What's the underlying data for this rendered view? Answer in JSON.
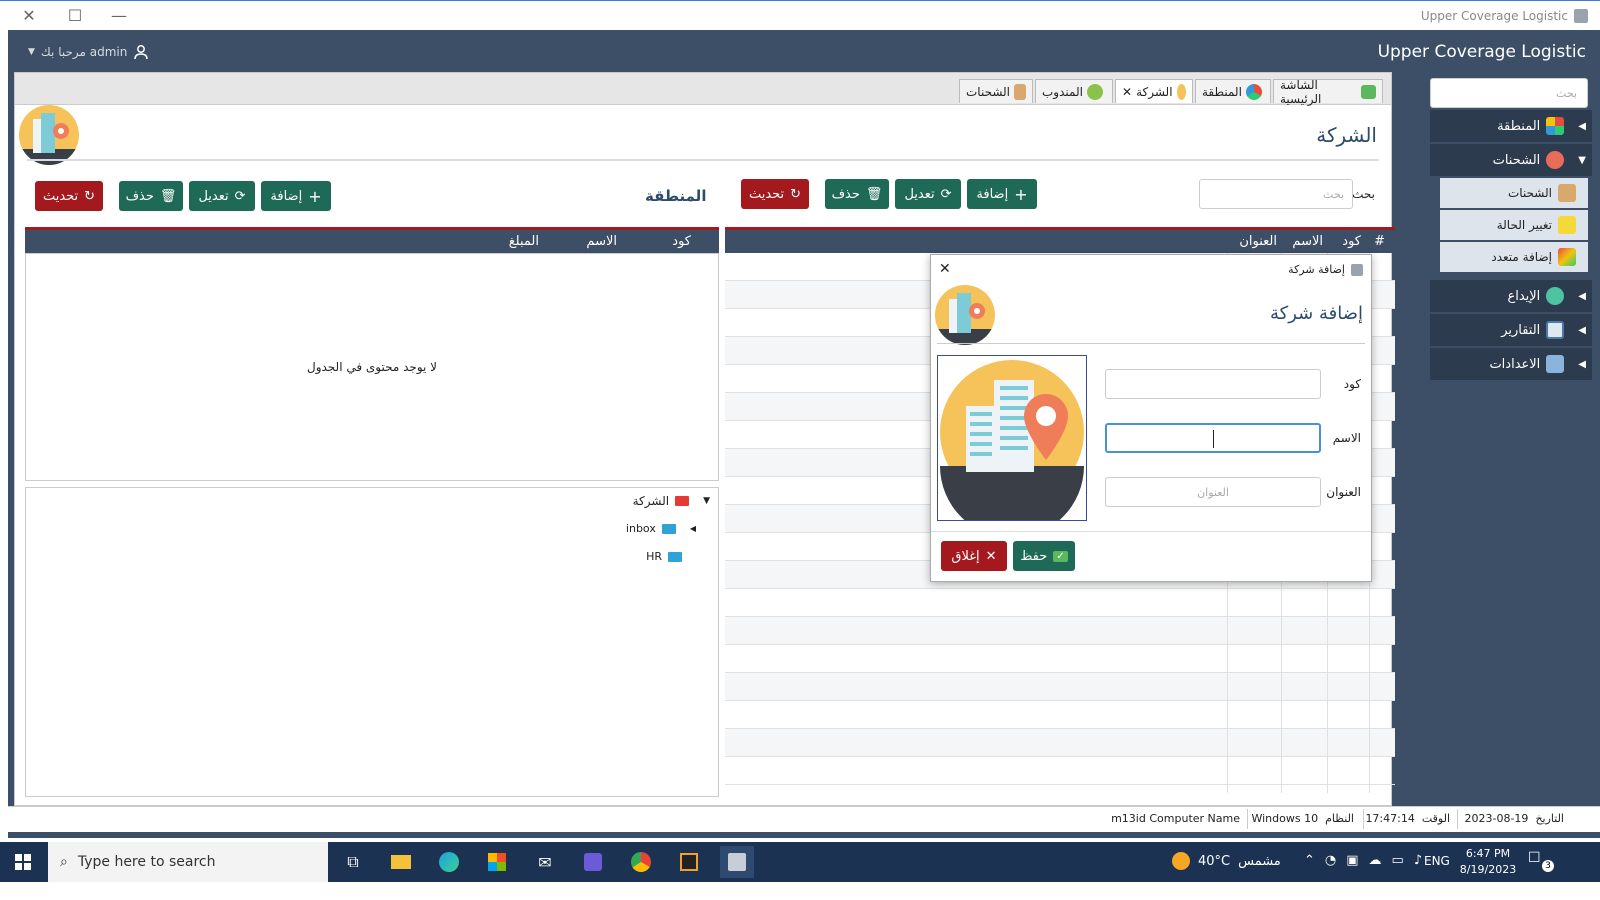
{
  "window": {
    "title": "Upper Coverage Logistic"
  },
  "header": {
    "brand": "Upper Coverage Logistic",
    "user": "مرحبا بك admin"
  },
  "sidebar": {
    "search_placeholder": "بحث",
    "items": [
      {
        "label": "المنطقة"
      },
      {
        "label": "الشحنات"
      },
      {
        "label": "الإيداع"
      },
      {
        "label": "التقارير"
      },
      {
        "label": "الاعدادات"
      }
    ],
    "sub_items": [
      {
        "label": "الشحنات"
      },
      {
        "label": "تغيير الحالة"
      },
      {
        "label": "إضافة متعدد"
      }
    ]
  },
  "tabs": [
    {
      "label": "الشاشة الرئيسية"
    },
    {
      "label": "المنطقة"
    },
    {
      "label": "الشركة"
    },
    {
      "label": "المندوب"
    },
    {
      "label": "الشحنات"
    }
  ],
  "page": {
    "title": "الشركة"
  },
  "company": {
    "search_label": "بحث",
    "search_placeholder": "بحث",
    "buttons": {
      "add": "إضافة",
      "edit": "تعديل",
      "delete": "حذف",
      "refresh": "تحديث"
    },
    "columns": [
      "#",
      "كود",
      "الاسم",
      "العنوان"
    ]
  },
  "region": {
    "title": "المنطقة",
    "buttons": {
      "add": "إضافة",
      "edit": "تعديل",
      "delete": "حذف",
      "refresh": "تحديث"
    },
    "columns": [
      "كود",
      "الاسم",
      "المبلغ"
    ],
    "empty": "لا يوجد محتوى في الجدول"
  },
  "tree": {
    "root": "الشركة",
    "children": [
      "inbox",
      "HR"
    ]
  },
  "modal": {
    "window_title": "إضافة شركة",
    "heading": "إضافة شركة",
    "fields": {
      "code_label": "كود",
      "name_label": "الاسم",
      "address_label": "العنوان",
      "address_placeholder": "العنوان"
    },
    "save": "حفظ",
    "close": "إغلاق"
  },
  "status": {
    "date_label": "التاريخ",
    "date": "2023-08-19",
    "time_label": "الوقت",
    "time": "17:47:14",
    "os_label": "النظام",
    "os": "Windows 10",
    "computer_label": "Computer Name",
    "computer": "m13id"
  },
  "taskbar": {
    "search_placeholder": "Type here to search",
    "weather": "40°C",
    "weather_desc": "مشمس",
    "lang": "ENG",
    "clock_time": "6:47 PM",
    "clock_date": "8/19/2023",
    "notifications": "3"
  },
  "colors": {
    "primary": "#3d4f66",
    "accent_green": "#1f6a57",
    "accent_red": "#a3191d"
  }
}
